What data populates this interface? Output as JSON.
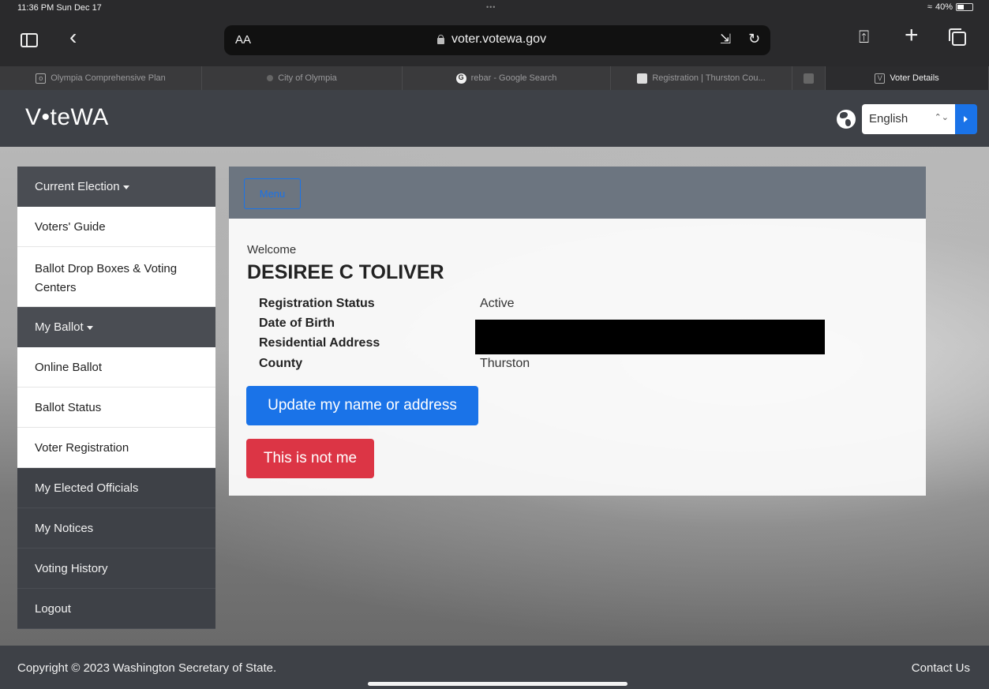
{
  "status": {
    "time": "11:36 PM  Sun Dec 17",
    "battery": "40%",
    "dots": "•••"
  },
  "browser": {
    "aa_label": "AA",
    "url": "voter.votewa.gov",
    "reader_glyph": "⇲",
    "reload_glyph": "↻",
    "share_glyph": "⍐",
    "plus_glyph": "+",
    "tabs": [
      {
        "label": "Olympia Comprehensive Plan",
        "icon": "box-icon",
        "icon_glyph": "o"
      },
      {
        "label": "City of Olympia",
        "icon": "dot-icon",
        "icon_glyph": ""
      },
      {
        "label": "rebar - Google Search",
        "icon": "google-icon",
        "icon_glyph": "G"
      },
      {
        "label": "Registration | Thurston Cou...",
        "icon": "site-icon",
        "icon_glyph": ""
      },
      {
        "label": "",
        "icon": "blank-tab-icon",
        "icon_glyph": ""
      },
      {
        "label": "Voter Details",
        "icon": "v-icon",
        "icon_glyph": "V",
        "active": true
      }
    ]
  },
  "site": {
    "logo": "V•teWA",
    "language": "English",
    "language_caret": "⌃⌄"
  },
  "sidenav": {
    "items": [
      {
        "label": "Current Election",
        "type": "header"
      },
      {
        "label": "Voters' Guide",
        "type": "light"
      },
      {
        "label": "Ballot Drop Boxes & Voting Centers",
        "type": "light-tall"
      },
      {
        "label": "My Ballot",
        "type": "header"
      },
      {
        "label": "Online Ballot",
        "type": "light"
      },
      {
        "label": "Ballot Status",
        "type": "light"
      },
      {
        "label": "Voter Registration",
        "type": "light"
      },
      {
        "label": "My Elected Officials",
        "type": "dark"
      },
      {
        "label": "My Notices",
        "type": "dark"
      },
      {
        "label": "Voting History",
        "type": "dark"
      },
      {
        "label": "Logout",
        "type": "dark"
      }
    ]
  },
  "content": {
    "menu_label": "Menu",
    "welcome": "Welcome",
    "name": "DESIREE C TOLIVER",
    "fields": [
      {
        "label": "Registration Status",
        "value": "Active"
      },
      {
        "label": "Date of Birth",
        "value": ""
      },
      {
        "label": "Residential Address",
        "value": ""
      },
      {
        "label": "County",
        "value": "Thurston"
      }
    ],
    "update_button": "Update my name or address",
    "not_me_button": "This is not me"
  },
  "footer": {
    "copyright": "Copyright © 2023 Washington Secretary of State.",
    "contact": "Contact Us"
  },
  "colors": {
    "header_bg": "#3e4147",
    "primary": "#1a73e8",
    "danger": "#dc3545"
  }
}
